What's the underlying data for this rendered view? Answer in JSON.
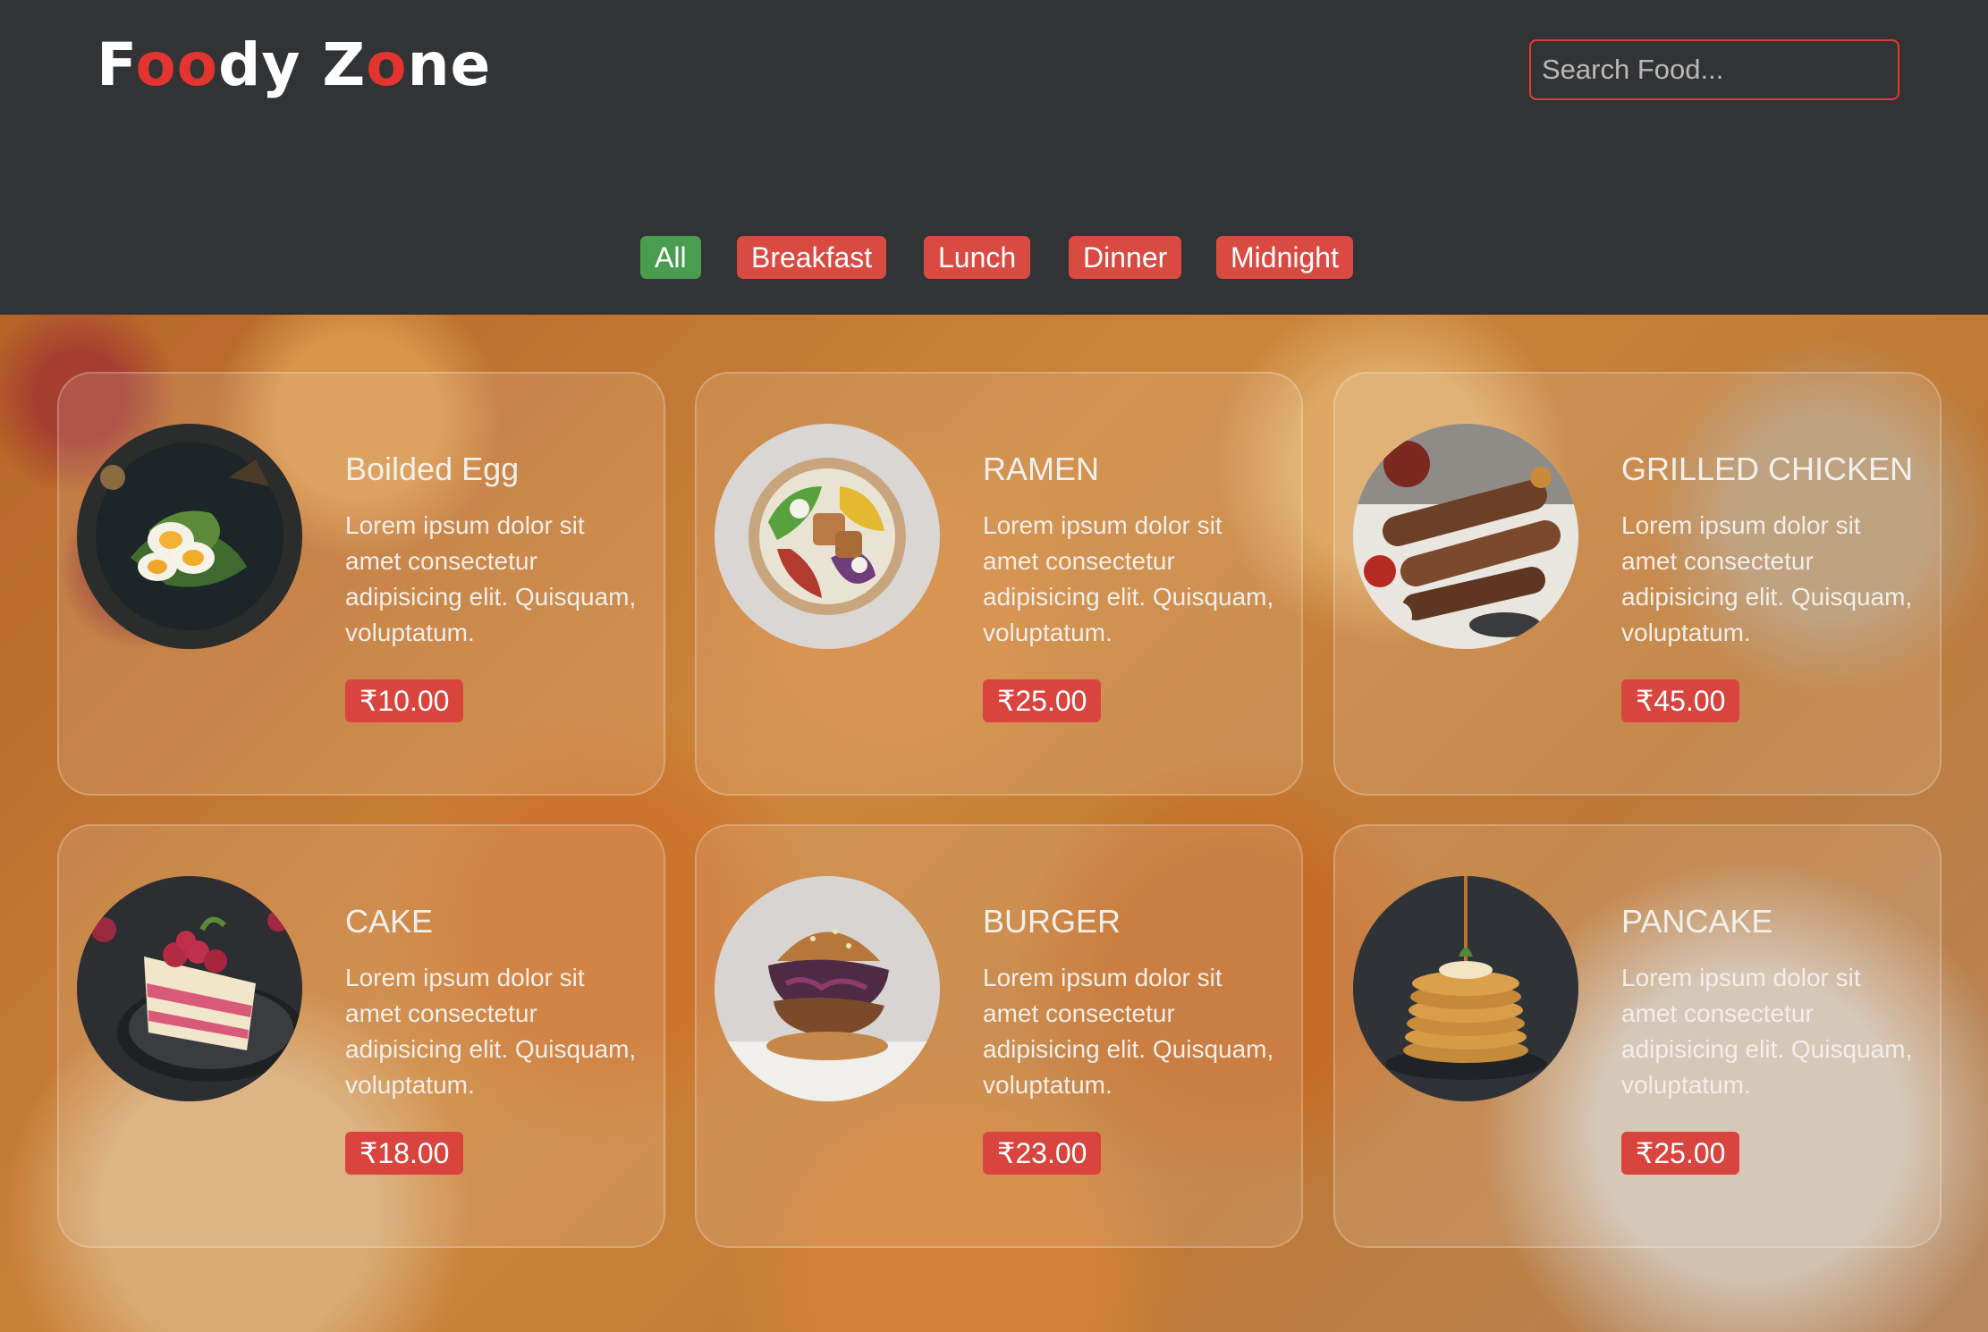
{
  "header": {
    "logo": {
      "parts": [
        {
          "text": "F",
          "color": "#ffffff"
        },
        {
          "text": "oo",
          "color": "#e3342f"
        },
        {
          "text": "dy Z",
          "color": "#ffffff"
        },
        {
          "text": "o",
          "color": "#e3342f"
        },
        {
          "text": "ne",
          "color": "#ffffff"
        }
      ]
    },
    "search_placeholder": "Search Food..."
  },
  "filters": [
    {
      "label": "All",
      "active": true
    },
    {
      "label": "Breakfast",
      "active": false
    },
    {
      "label": "Lunch",
      "active": false
    },
    {
      "label": "Dinner",
      "active": false
    },
    {
      "label": "Midnight",
      "active": false
    }
  ],
  "foods": [
    {
      "name": "Boilded Egg",
      "description": "Lorem ipsum dolor sit amet consectetur adipisicing elit. Quisquam, voluptatum.",
      "price": "₹10.00",
      "image_icon": "boiled-egg-plate-icon"
    },
    {
      "name": "RAMEN",
      "description": "Lorem ipsum dolor sit amet consectetur adipisicing elit. Quisquam, voluptatum.",
      "price": "₹25.00",
      "image_icon": "salad-bowl-icon"
    },
    {
      "name": "GRILLED CHICKEN",
      "description": "Lorem ipsum dolor sit amet consectetur adipisicing elit. Quisquam, voluptatum.",
      "price": "₹45.00",
      "image_icon": "grilled-chicken-skewers-icon"
    },
    {
      "name": "CAKE",
      "description": "Lorem ipsum dolor sit amet consectetur adipisicing elit. Quisquam, voluptatum.",
      "price": "₹18.00",
      "image_icon": "cake-slice-icon"
    },
    {
      "name": "BURGER",
      "description": "Lorem ipsum dolor sit amet consectetur adipisicing elit. Quisquam, voluptatum.",
      "price": "₹23.00",
      "image_icon": "burger-icon"
    },
    {
      "name": "PANCAKE",
      "description": "Lorem ipsum dolor sit amet consectetur adipisicing elit. Quisquam, voluptatum.",
      "price": "₹25.00",
      "image_icon": "pancake-stack-icon"
    }
  ],
  "colors": {
    "accent": "#d9443f",
    "active_filter": "#4a9d4f",
    "header_bg": "#323334"
  }
}
